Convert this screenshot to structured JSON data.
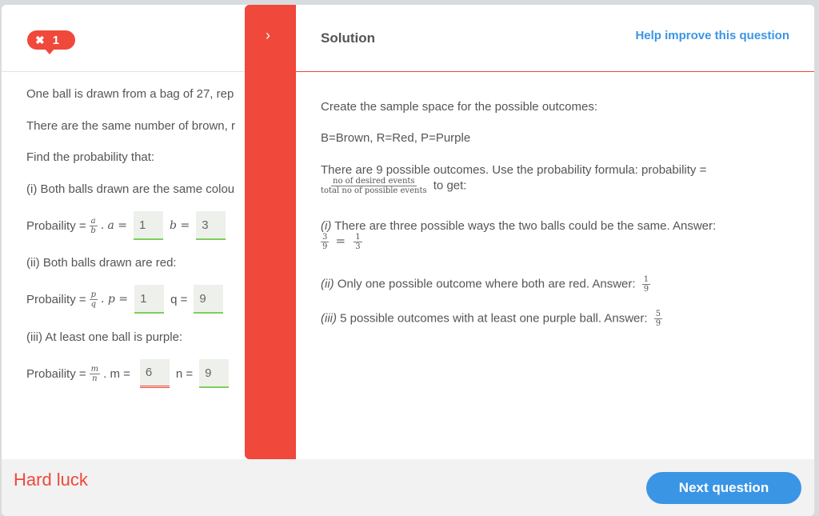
{
  "header": {
    "mistakes_icon": "close-icon",
    "mistakes_count": "1"
  },
  "question": {
    "intro": "One ball is drawn from a bag of 27, rep",
    "same_number": "There are the same number of brown, r",
    "find": "Find the probability that:",
    "part1": "(i) Both balls drawn are the same colou",
    "part1_prob": "Probaility =",
    "part1_frac_num": "a",
    "part1_frac_den": "b",
    "part1_a_label": ". a =",
    "part1_a_value": "1",
    "part1_b_label": "b =",
    "part1_b_value": "3",
    "part2": "(ii) Both balls drawn are red:",
    "part2_prob": "Probaility =",
    "part2_frac_num": "p",
    "part2_frac_den": "q",
    "part2_p_label": ". p =",
    "part2_p_value": "1",
    "part2_q_label": "q =",
    "part2_q_value": "9",
    "part3": "(iii) At least one ball is purple:",
    "part3_prob": "Probaility =",
    "part3_frac_num": "m",
    "part3_frac_den": "n",
    "part3_m_label": ". m =",
    "part3_m_value": "6",
    "part3_n_label": "n =",
    "part3_n_value": "9"
  },
  "panel": {
    "chevron": "›",
    "title": "Solution",
    "help_link": "Help improve this question",
    "line1": "Create the sample space for the possible outcomes:",
    "line2": "B=Brown, R=Red, P=Purple",
    "line3": "There are 9 possible outcomes. Use the probability formula: probability =",
    "formula_num": "no  of  desired  events",
    "formula_den": "total  no  of  possible  events",
    "line3_end": "to get:",
    "i_label": "(i)",
    "i_text": "There are three possible ways the two balls could be the same. Answer:",
    "i_f1_num": "3",
    "i_f1_den": "9",
    "i_eq": "=",
    "i_f2_num": "1",
    "i_f2_den": "3",
    "ii_label": "(ii)",
    "ii_text": "Only one possible outcome where both are red. Answer:",
    "ii_num": "1",
    "ii_den": "9",
    "iii_label": "(iii)",
    "iii_text": "5 possible outcomes with at least one purple ball. Answer:",
    "iii_num": "5",
    "iii_den": "9"
  },
  "footer": {
    "result": "Hard luck",
    "next_button": "Next question"
  },
  "colors": {
    "accent_red": "#f0483a",
    "accent_blue": "#3b95e5",
    "correct_green": "#7ccf5a"
  }
}
